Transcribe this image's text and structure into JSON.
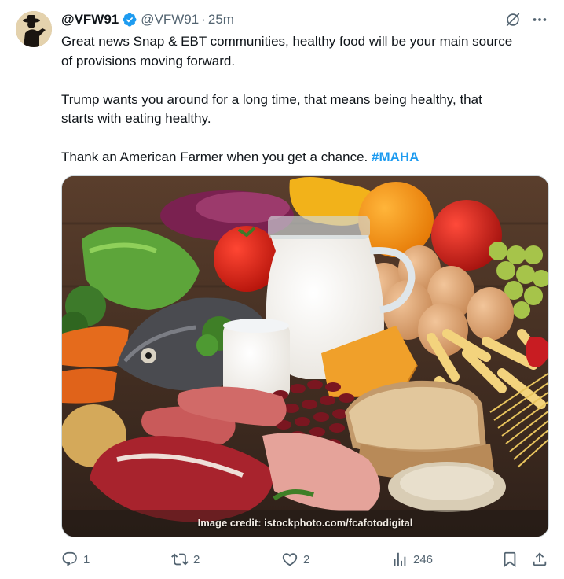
{
  "tweet": {
    "display_name": "@VFW91",
    "handle": "@VFW91",
    "separator": "·",
    "time": "25m",
    "text_lines": {
      "p1a": "Great news Snap & EBT communities, healthy food will be your main source",
      "p1b": "of provisions moving forward.",
      "p2a": "Trump wants you around for a long time, that means being healthy, that",
      "p2b": "starts with eating healthy.",
      "p3": "Thank an American Farmer when you get a chance. ",
      "hashtag": "#MAHA"
    },
    "media_credit": "Image credit: istockphoto.com/fcafotodigital"
  },
  "actions": {
    "reply_count": "1",
    "repost_count": "2",
    "like_count": "2",
    "views_count": "246"
  },
  "icons": {
    "verified": "verified-badge-icon",
    "grok": "grok-icon",
    "more": "more-icon",
    "reply": "reply-icon",
    "repost": "repost-icon",
    "like": "like-icon",
    "views": "views-icon",
    "bookmark": "bookmark-icon",
    "share": "share-icon"
  },
  "colors": {
    "accent": "#1d9bf0",
    "secondary_text": "#536471",
    "primary_text": "#0f1419"
  }
}
